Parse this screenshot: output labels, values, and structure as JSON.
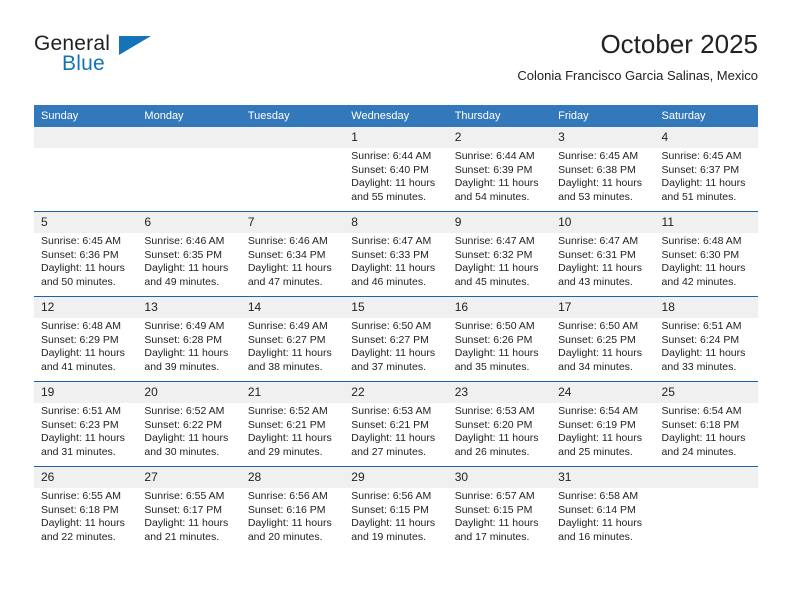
{
  "logo": {
    "word_one": "General",
    "word_two": "Blue",
    "accent_color": "#1573ba",
    "triangle_icon": "triangle-icon"
  },
  "header": {
    "title": "October 2025",
    "subtitle": "Colonia Francisco Garcia Salinas, Mexico"
  },
  "calendar": {
    "header_bg": "#3478bc",
    "row_divider_color": "#1c63a8",
    "daynum_bg": "#f0f0f0",
    "weekday_headers": [
      "Sunday",
      "Monday",
      "Tuesday",
      "Wednesday",
      "Thursday",
      "Friday",
      "Saturday"
    ],
    "labels": {
      "sunrise": "Sunrise:",
      "sunset": "Sunset:",
      "daylight": "Daylight:"
    },
    "weeks": [
      [
        {
          "day": "",
          "sunrise": "",
          "sunset": "",
          "daylight": ""
        },
        {
          "day": "",
          "sunrise": "",
          "sunset": "",
          "daylight": ""
        },
        {
          "day": "",
          "sunrise": "",
          "sunset": "",
          "daylight": ""
        },
        {
          "day": "1",
          "sunrise": "Sunrise: 6:44 AM",
          "sunset": "Sunset: 6:40 PM",
          "daylight": "Daylight: 11 hours and 55 minutes."
        },
        {
          "day": "2",
          "sunrise": "Sunrise: 6:44 AM",
          "sunset": "Sunset: 6:39 PM",
          "daylight": "Daylight: 11 hours and 54 minutes."
        },
        {
          "day": "3",
          "sunrise": "Sunrise: 6:45 AM",
          "sunset": "Sunset: 6:38 PM",
          "daylight": "Daylight: 11 hours and 53 minutes."
        },
        {
          "day": "4",
          "sunrise": "Sunrise: 6:45 AM",
          "sunset": "Sunset: 6:37 PM",
          "daylight": "Daylight: 11 hours and 51 minutes."
        }
      ],
      [
        {
          "day": "5",
          "sunrise": "Sunrise: 6:45 AM",
          "sunset": "Sunset: 6:36 PM",
          "daylight": "Daylight: 11 hours and 50 minutes."
        },
        {
          "day": "6",
          "sunrise": "Sunrise: 6:46 AM",
          "sunset": "Sunset: 6:35 PM",
          "daylight": "Daylight: 11 hours and 49 minutes."
        },
        {
          "day": "7",
          "sunrise": "Sunrise: 6:46 AM",
          "sunset": "Sunset: 6:34 PM",
          "daylight": "Daylight: 11 hours and 47 minutes."
        },
        {
          "day": "8",
          "sunrise": "Sunrise: 6:47 AM",
          "sunset": "Sunset: 6:33 PM",
          "daylight": "Daylight: 11 hours and 46 minutes."
        },
        {
          "day": "9",
          "sunrise": "Sunrise: 6:47 AM",
          "sunset": "Sunset: 6:32 PM",
          "daylight": "Daylight: 11 hours and 45 minutes."
        },
        {
          "day": "10",
          "sunrise": "Sunrise: 6:47 AM",
          "sunset": "Sunset: 6:31 PM",
          "daylight": "Daylight: 11 hours and 43 minutes."
        },
        {
          "day": "11",
          "sunrise": "Sunrise: 6:48 AM",
          "sunset": "Sunset: 6:30 PM",
          "daylight": "Daylight: 11 hours and 42 minutes."
        }
      ],
      [
        {
          "day": "12",
          "sunrise": "Sunrise: 6:48 AM",
          "sunset": "Sunset: 6:29 PM",
          "daylight": "Daylight: 11 hours and 41 minutes."
        },
        {
          "day": "13",
          "sunrise": "Sunrise: 6:49 AM",
          "sunset": "Sunset: 6:28 PM",
          "daylight": "Daylight: 11 hours and 39 minutes."
        },
        {
          "day": "14",
          "sunrise": "Sunrise: 6:49 AM",
          "sunset": "Sunset: 6:27 PM",
          "daylight": "Daylight: 11 hours and 38 minutes."
        },
        {
          "day": "15",
          "sunrise": "Sunrise: 6:50 AM",
          "sunset": "Sunset: 6:27 PM",
          "daylight": "Daylight: 11 hours and 37 minutes."
        },
        {
          "day": "16",
          "sunrise": "Sunrise: 6:50 AM",
          "sunset": "Sunset: 6:26 PM",
          "daylight": "Daylight: 11 hours and 35 minutes."
        },
        {
          "day": "17",
          "sunrise": "Sunrise: 6:50 AM",
          "sunset": "Sunset: 6:25 PM",
          "daylight": "Daylight: 11 hours and 34 minutes."
        },
        {
          "day": "18",
          "sunrise": "Sunrise: 6:51 AM",
          "sunset": "Sunset: 6:24 PM",
          "daylight": "Daylight: 11 hours and 33 minutes."
        }
      ],
      [
        {
          "day": "19",
          "sunrise": "Sunrise: 6:51 AM",
          "sunset": "Sunset: 6:23 PM",
          "daylight": "Daylight: 11 hours and 31 minutes."
        },
        {
          "day": "20",
          "sunrise": "Sunrise: 6:52 AM",
          "sunset": "Sunset: 6:22 PM",
          "daylight": "Daylight: 11 hours and 30 minutes."
        },
        {
          "day": "21",
          "sunrise": "Sunrise: 6:52 AM",
          "sunset": "Sunset: 6:21 PM",
          "daylight": "Daylight: 11 hours and 29 minutes."
        },
        {
          "day": "22",
          "sunrise": "Sunrise: 6:53 AM",
          "sunset": "Sunset: 6:21 PM",
          "daylight": "Daylight: 11 hours and 27 minutes."
        },
        {
          "day": "23",
          "sunrise": "Sunrise: 6:53 AM",
          "sunset": "Sunset: 6:20 PM",
          "daylight": "Daylight: 11 hours and 26 minutes."
        },
        {
          "day": "24",
          "sunrise": "Sunrise: 6:54 AM",
          "sunset": "Sunset: 6:19 PM",
          "daylight": "Daylight: 11 hours and 25 minutes."
        },
        {
          "day": "25",
          "sunrise": "Sunrise: 6:54 AM",
          "sunset": "Sunset: 6:18 PM",
          "daylight": "Daylight: 11 hours and 24 minutes."
        }
      ],
      [
        {
          "day": "26",
          "sunrise": "Sunrise: 6:55 AM",
          "sunset": "Sunset: 6:18 PM",
          "daylight": "Daylight: 11 hours and 22 minutes."
        },
        {
          "day": "27",
          "sunrise": "Sunrise: 6:55 AM",
          "sunset": "Sunset: 6:17 PM",
          "daylight": "Daylight: 11 hours and 21 minutes."
        },
        {
          "day": "28",
          "sunrise": "Sunrise: 6:56 AM",
          "sunset": "Sunset: 6:16 PM",
          "daylight": "Daylight: 11 hours and 20 minutes."
        },
        {
          "day": "29",
          "sunrise": "Sunrise: 6:56 AM",
          "sunset": "Sunset: 6:15 PM",
          "daylight": "Daylight: 11 hours and 19 minutes."
        },
        {
          "day": "30",
          "sunrise": "Sunrise: 6:57 AM",
          "sunset": "Sunset: 6:15 PM",
          "daylight": "Daylight: 11 hours and 17 minutes."
        },
        {
          "day": "31",
          "sunrise": "Sunrise: 6:58 AM",
          "sunset": "Sunset: 6:14 PM",
          "daylight": "Daylight: 11 hours and 16 minutes."
        },
        {
          "day": "",
          "sunrise": "",
          "sunset": "",
          "daylight": ""
        }
      ]
    ]
  }
}
